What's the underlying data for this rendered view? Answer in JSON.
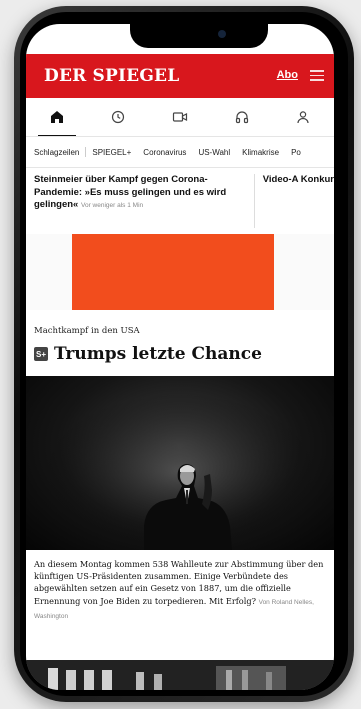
{
  "header": {
    "logo": "DER SPIEGEL",
    "abo_label": "Abo",
    "accent_color": "#d8171d"
  },
  "icon_nav": [
    {
      "name": "home-icon",
      "active": true
    },
    {
      "name": "clock-icon",
      "active": false
    },
    {
      "name": "video-icon",
      "active": false
    },
    {
      "name": "headphones-icon",
      "active": false
    },
    {
      "name": "user-icon",
      "active": false
    }
  ],
  "tabs": [
    "Schlagzeilen",
    "SPIEGEL+",
    "Coronavirus",
    "US-Wahl",
    "Klimakrise",
    "Po"
  ],
  "ticker": [
    {
      "title": "Steinmeier über Kampf gegen Corona-Pandemie: »Es muss gelingen und es wird gelingen«",
      "meta": "Vor weniger als 1 Min"
    },
    {
      "title": "Video-A Konkur"
    }
  ],
  "ad": {
    "color": "#f24d1d"
  },
  "article": {
    "kicker": "Machtkampf in den USA",
    "badge": "S+",
    "headline": "Trumps letzte Chance",
    "teaser": "An diesem Montag kommen 538 Wahlleute zur Abstimmung über den künftigen US-Präsidenten zusammen. Einige Verbündete des abgewählten setzen auf ein Gesetz von 1887, um die offizielle Ernennung von Joe Biden zu torpedieren. Mit Erfolg?",
    "author": "Von Roland Nelles, Washington"
  }
}
